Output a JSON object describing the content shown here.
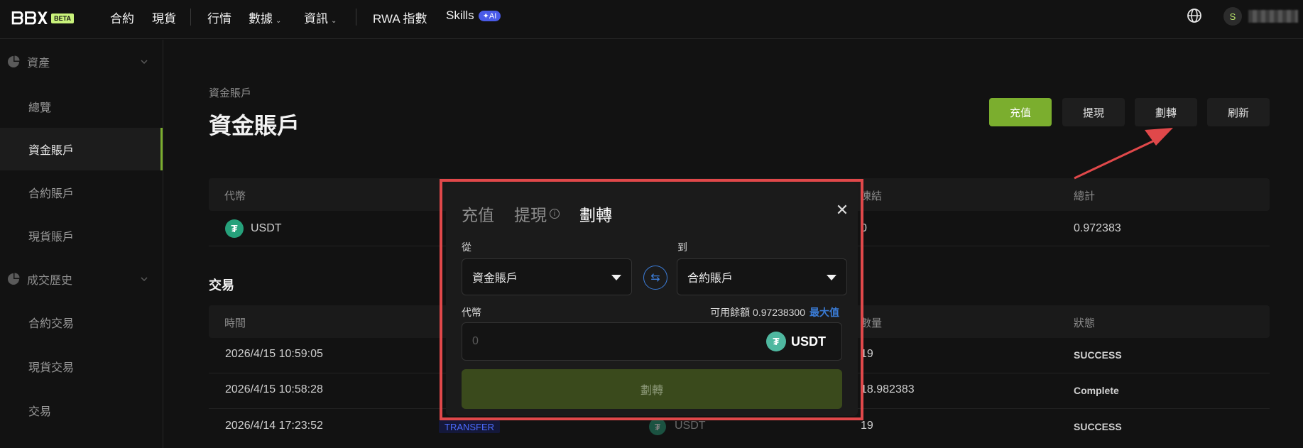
{
  "nav": {
    "logo_text": "ᗷᗷX",
    "beta": "BETA",
    "items": [
      "合約",
      "現貨",
      "行情",
      "數據",
      "資訊",
      "RWA 指數",
      "Skills"
    ],
    "ai_badge": "AI",
    "avatar_letter": "S"
  },
  "sidebar": {
    "assets_label": "資產",
    "assets_items": [
      "總覽",
      "資金賬戶",
      "合約賬戶",
      "現貨賬戶"
    ],
    "history_label": "成交歷史",
    "history_items": [
      "合約交易",
      "現貨交易",
      "交易"
    ]
  },
  "main": {
    "breadcrumb": "資金賬戶",
    "title": "資金賬戶",
    "buttons": {
      "deposit": "充值",
      "withdraw": "提現",
      "transfer": "劃轉",
      "refresh": "刷新"
    },
    "balance_table": {
      "headers": [
        "代幣",
        "凍結",
        "總計"
      ],
      "row": {
        "coin": "USDT",
        "frozen": "0",
        "total": "0.972383"
      }
    },
    "tx_section_title": "交易",
    "tx_table": {
      "headers": [
        "時間",
        "數量",
        "狀態"
      ],
      "rows": [
        {
          "time": "2026/4/15 10:59:05",
          "amount": "19",
          "status": "SUCCESS"
        },
        {
          "time": "2026/4/15 10:58:28",
          "amount": "18.982383",
          "status": "Complete"
        },
        {
          "time": "2026/4/14 17:23:52",
          "amount": "19",
          "status": "SUCCESS",
          "type": "TRANSFER",
          "coin": "USDT"
        }
      ]
    }
  },
  "modal": {
    "tabs": [
      "充值",
      "提現",
      "劃轉"
    ],
    "active_tab": "劃轉",
    "from_label": "從",
    "to_label": "到",
    "from_value": "資金賬戶",
    "to_value": "合約賬戶",
    "token_label": "代幣",
    "available_text": "可用餘額 0.97238300",
    "max_label": "最大值",
    "amount_placeholder": "0",
    "token_symbol": "USDT",
    "submit_label": "劃轉"
  },
  "colors": {
    "accent": "#7bae2e",
    "highlight": "#e0484a",
    "link": "#3a7bd5"
  }
}
